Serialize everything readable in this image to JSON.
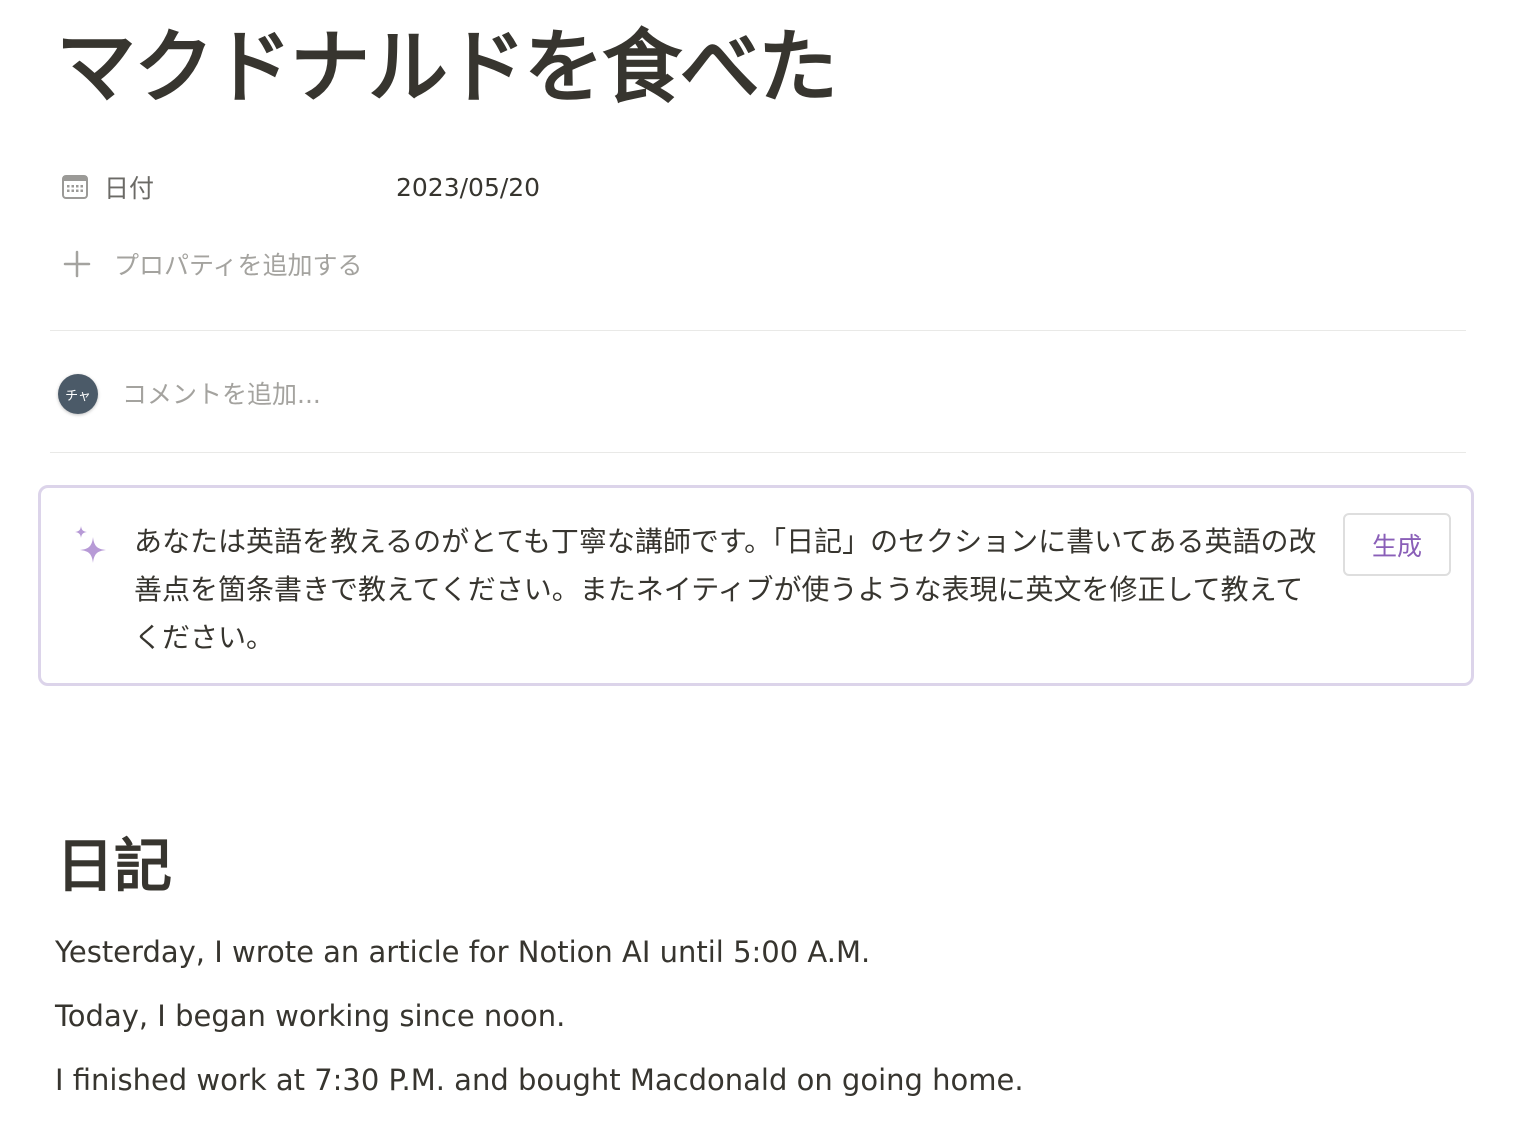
{
  "page": {
    "title": "マクドナルドを食べた"
  },
  "properties": [
    {
      "icon": "calendar-icon",
      "name": "日付",
      "value": "2023/05/20"
    }
  ],
  "add_property": {
    "icon": "plus-icon",
    "label": "プロパティを追加する"
  },
  "comment": {
    "avatar_text": "チャ",
    "placeholder": "コメントを追加..."
  },
  "ai_block": {
    "icon": "sparkle-icon",
    "prompt": "あなたは英語を教えるのがとても丁寧な講師です。「日記」のセクションに書いてある英語の改善点を箇条書きで教えてください。またネイティブが使うような表現に英文を修正して教えてください。",
    "generate_label": "生成",
    "accent_color": "#8a5fb8",
    "border_color": "#dcd4ea"
  },
  "diary": {
    "heading": "日記",
    "paragraphs": [
      "Yesterday, I wrote an article for Notion AI until 5:00 A.M.",
      "Today, I began working since noon.",
      "I finished work at 7:30 P.M. and bought Macdonald on going home."
    ]
  }
}
